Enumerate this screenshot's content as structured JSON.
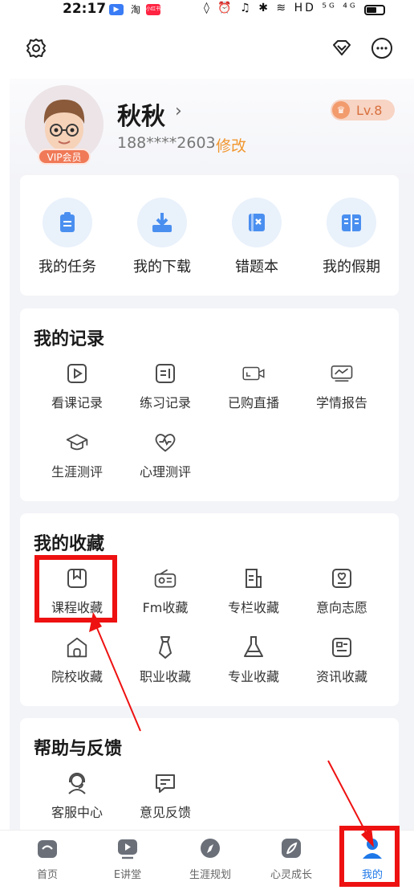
{
  "status": {
    "time": "22:17",
    "apps": [
      "淘",
      "小红书"
    ],
    "right_icons": "◊ ⏰ ♫ ✱ ≋ HD ⁵ᴳ ⁴ᴳ"
  },
  "profile": {
    "name": "秋秋",
    "phone": "188****2603",
    "modify_label": "修改",
    "vip_label": "VIP会员",
    "level": "Lv.8"
  },
  "quick_actions": [
    {
      "label": "我的任务",
      "icon": "clipboard-icon"
    },
    {
      "label": "我的下载",
      "icon": "download-icon"
    },
    {
      "label": "错题本",
      "icon": "wrong-book-icon"
    },
    {
      "label": "我的假期",
      "icon": "holiday-book-icon"
    }
  ],
  "records": {
    "title": "我的记录",
    "items": [
      {
        "label": "看课记录",
        "icon": "play-record-icon"
      },
      {
        "label": "练习记录",
        "icon": "practice-icon"
      },
      {
        "label": "已购直播",
        "icon": "live-camera-icon"
      },
      {
        "label": "学情报告",
        "icon": "report-monitor-icon"
      },
      {
        "label": "生涯测评",
        "icon": "graduation-cap-icon"
      },
      {
        "label": "心理测评",
        "icon": "heart-pulse-icon"
      }
    ]
  },
  "favorites": {
    "title": "我的收藏",
    "items": [
      {
        "label": "课程收藏",
        "icon": "course-bookmark-icon"
      },
      {
        "label": "Fm收藏",
        "icon": "radio-icon"
      },
      {
        "label": "专栏收藏",
        "icon": "column-doc-icon"
      },
      {
        "label": "意向志愿",
        "icon": "heart-frame-icon"
      },
      {
        "label": "院校收藏",
        "icon": "school-icon"
      },
      {
        "label": "职业收藏",
        "icon": "tie-icon"
      },
      {
        "label": "专业收藏",
        "icon": "flask-icon"
      },
      {
        "label": "资讯收藏",
        "icon": "news-icon"
      }
    ]
  },
  "help": {
    "title": "帮助与反馈",
    "items": [
      {
        "label": "客服中心",
        "icon": "headset-icon"
      },
      {
        "label": "意见反馈",
        "icon": "feedback-icon"
      }
    ]
  },
  "tabs": [
    {
      "label": "首页",
      "icon": "home-icon"
    },
    {
      "label": "E讲堂",
      "icon": "video-icon"
    },
    {
      "label": "生涯规划",
      "icon": "compass-icon"
    },
    {
      "label": "心灵成长",
      "icon": "leaf-icon"
    },
    {
      "label": "我的",
      "icon": "profile-icon"
    }
  ],
  "colors": {
    "accent": "#1e78e8",
    "modify": "#f1962e",
    "vip": "#f07a58",
    "highlight": "#ee1111",
    "icon_stroke": "#4a4a4a"
  }
}
